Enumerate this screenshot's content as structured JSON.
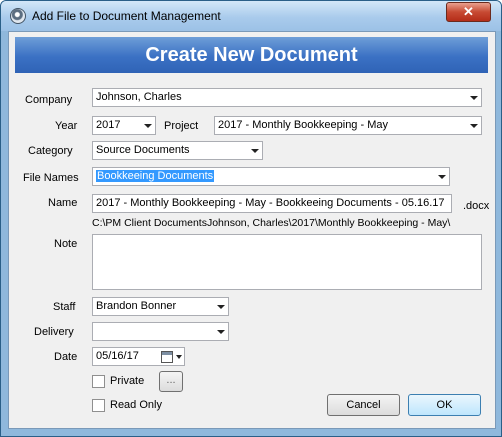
{
  "window": {
    "title": "Add File to Document Management",
    "close_label": "✕"
  },
  "banner": {
    "title": "Create New Document"
  },
  "form": {
    "company_label": "Company",
    "company_value": "Johnson, Charles",
    "year_label": "Year",
    "year_value": "2017",
    "project_label": "Project",
    "project_value": "2017 - Monthly Bookkeeping - May",
    "category_label": "Category",
    "category_value": "Source Documents",
    "file_names_label": "File Names",
    "file_names_value": "Bookkeeing Documents",
    "name_label": "Name",
    "name_value": "2017 - Monthly Bookkeeping - May - Bookkeeing Documents - 05.16.17",
    "name_extension": ".docx",
    "path": "C:\\PM Client DocumentsJohnson, Charles\\2017\\Monthly Bookkeeping - May\\",
    "note_label": "Note",
    "note_value": "",
    "staff_label": "Staff",
    "staff_value": "Brandon Bonner",
    "delivery_label": "Delivery",
    "delivery_value": "",
    "date_label": "Date",
    "date_value": "05/16/17",
    "private_label": "Private",
    "private_checked": false,
    "private_more_label": "...",
    "read_only_label": "Read Only",
    "read_only_checked": false
  },
  "buttons": {
    "cancel_label": "Cancel",
    "ok_label": "OK"
  },
  "icons": {
    "app": "app-gear-icon",
    "close": "close-icon",
    "dropdown": "chevron-down-icon",
    "calendar": "calendar-icon"
  },
  "colors": {
    "banner": "#3b71c4",
    "close_button": "#c74a33",
    "selection": "#3399ff"
  }
}
